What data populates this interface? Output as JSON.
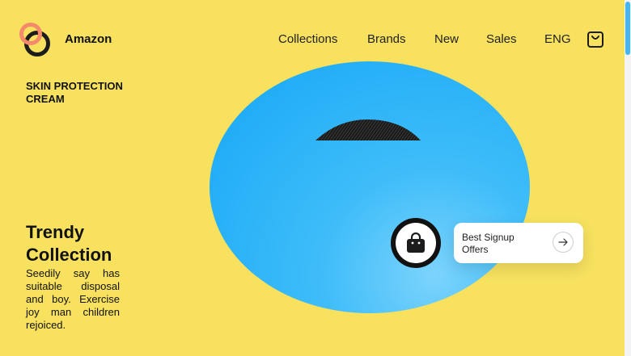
{
  "brand": {
    "name": "Amazon"
  },
  "nav": {
    "items": [
      {
        "label": "Collections"
      },
      {
        "label": "Brands"
      },
      {
        "label": "New"
      },
      {
        "label": "Sales"
      },
      {
        "label": "ENG"
      }
    ]
  },
  "hero": {
    "headline": "SKIN PROTECTION CREAM",
    "title": "Trendy Collection",
    "description": "Seedily say has suitable disposal and boy. Exercise joy man children rejoiced."
  },
  "offer": {
    "label": "Best Signup Offers"
  },
  "icons": {
    "cart": "shopping-bag-icon",
    "shop": "shopping-bag-icon",
    "arrow": "arrow-right-icon"
  },
  "colors": {
    "background": "#f7e15f",
    "accent": "#f48a6b",
    "blob": "#29b3f8",
    "dark": "#1c1c1c"
  }
}
